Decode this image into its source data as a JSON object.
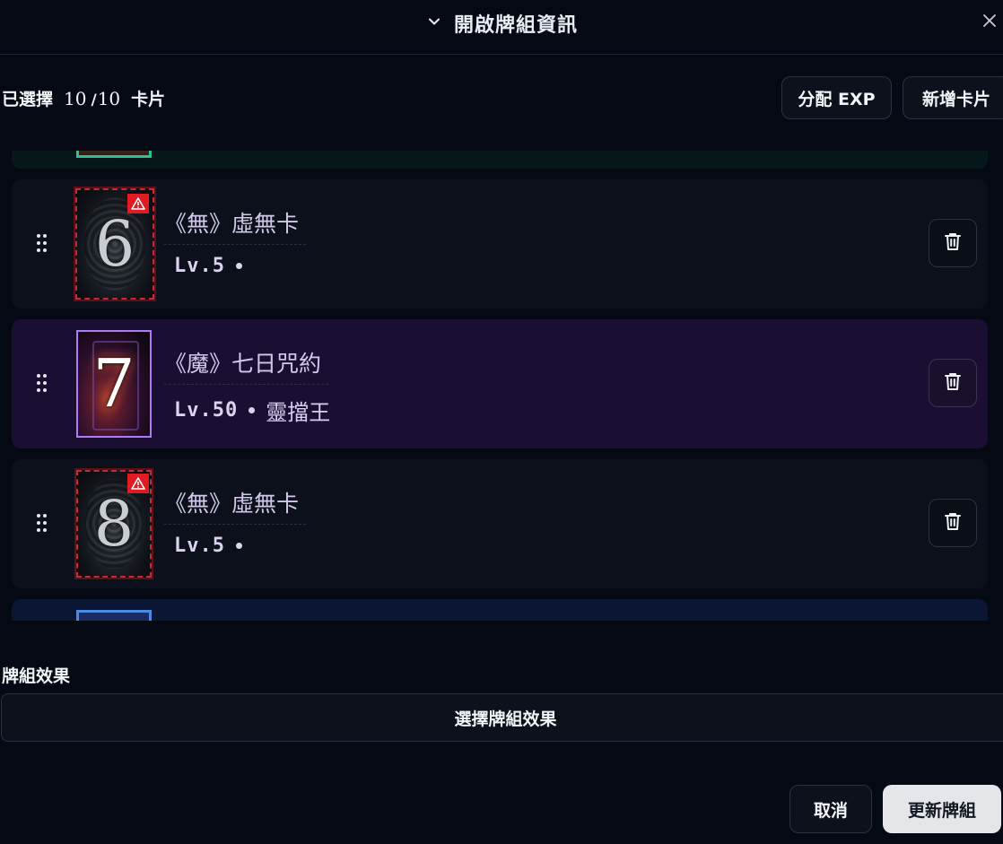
{
  "header": {
    "title": "開啟牌組資訊",
    "toggle_icon": "chevron-down-icon",
    "close_icon": "close-icon"
  },
  "toolbar": {
    "selected_prefix": "已選擇",
    "selected_count": "10",
    "selected_separator": "/",
    "selected_total": "10",
    "selected_suffix": "卡片",
    "assign_exp_label": "分配 EXP",
    "add_card_label": "新增卡片"
  },
  "cards": [
    {
      "slot": "6",
      "name": "《無》虛無卡",
      "level": "Lv.5",
      "owner": "",
      "type": "void",
      "warning": true
    },
    {
      "slot": "7",
      "name": "《魔》七日咒約",
      "level": "Lv.50",
      "owner": "靈擋王",
      "type": "demon",
      "warning": false
    },
    {
      "slot": "8",
      "name": "《無》虛無卡",
      "level": "Lv.5",
      "owner": "",
      "type": "void",
      "warning": true
    }
  ],
  "colors": {
    "background": "#050913",
    "card_row": "#0b101a",
    "card_row_demon": "#1b0e33",
    "card_row_next": "#0b1635",
    "void_border": "#c42a3a",
    "demon_border": "#b07cf5",
    "warning": "#e21b23",
    "primary_button": "#e4e6ea"
  },
  "effect": {
    "label": "牌組效果",
    "select_label": "選擇牌組效果"
  },
  "footer": {
    "cancel_label": "取消",
    "update_label": "更新牌組"
  }
}
